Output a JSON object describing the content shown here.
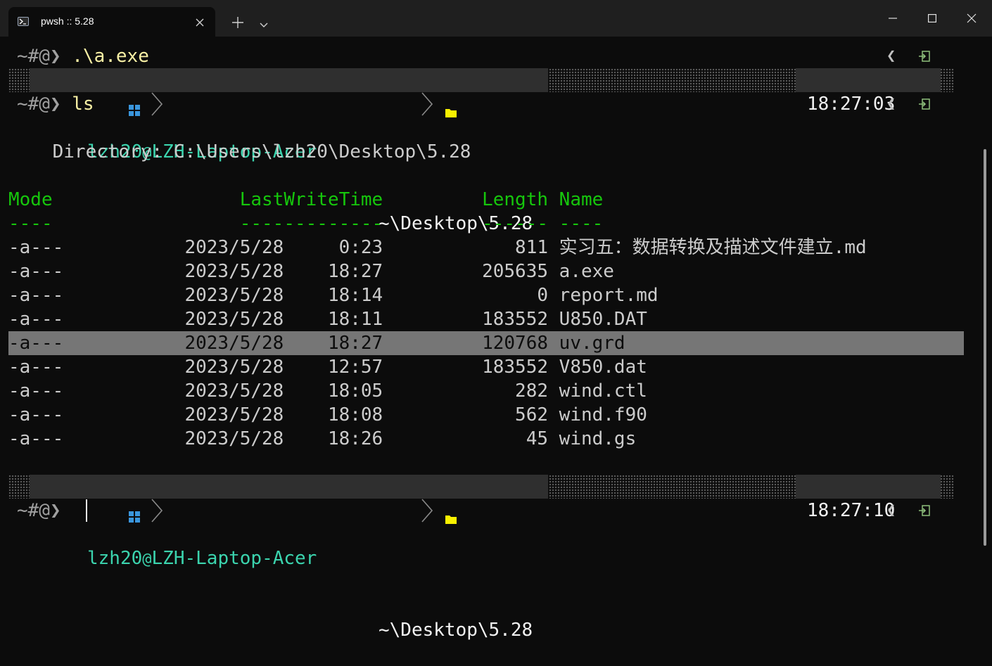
{
  "tab": {
    "title": "pwsh :: 5.28"
  },
  "colors": {
    "accent_user": "#3bd4ae",
    "header_green": "#16c60c",
    "command_yellow": "#f9f1a5",
    "folder_yellow": "#f9f100",
    "clock_blue": "#3a96dd"
  },
  "prompt": {
    "symbol": "~#@❯ "
  },
  "commands": {
    "first": ".\\a.exe",
    "second": "ls"
  },
  "status1": {
    "user": "lzh20",
    "at": "@",
    "host": "LZH-Laptop-Acer",
    "path": "~\\Desktop\\5.28",
    "time": "18:27:03"
  },
  "status2": {
    "user": "lzh20",
    "at": "@",
    "host": "LZH-Laptop-Acer",
    "path": "~\\Desktop\\5.28",
    "time": "18:27:10"
  },
  "gutter_glyph": "❮",
  "listing": {
    "directory": "    Directory: C:\\Users\\lzh20\\Desktop\\5.28",
    "header": "Mode                 LastWriteTime         Length Name",
    "underline": "----                 -------------         ------ ----",
    "rows": [
      "-a---           2023/5/28     0:23            811 实习五：数据转换及描述文件建立.md",
      "-a---           2023/5/28    18:27         205635 a.exe",
      "-a---           2023/5/28    18:14              0 report.md",
      "-a---           2023/5/28    18:11         183552 U850.DAT",
      "-a---           2023/5/28    18:27         120768 uv.grd",
      "-a---           2023/5/28    12:57         183552 V850.dat",
      "-a---           2023/5/28    18:05            282 wind.ctl",
      "-a---           2023/5/28    18:08            562 wind.f90",
      "-a---           2023/5/28    18:26             45 wind.gs"
    ]
  }
}
